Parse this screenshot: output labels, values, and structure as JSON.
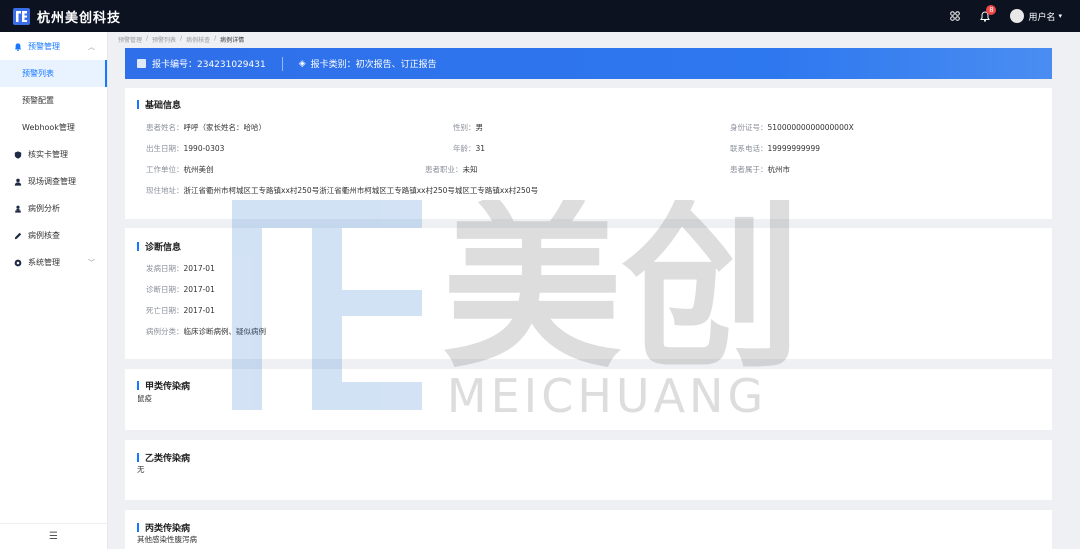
{
  "header": {
    "brand": "杭州美创科技",
    "notification_count": "8",
    "username": "用户名"
  },
  "sidebar": {
    "groups": [
      {
        "label": "预警管理",
        "icon": "bell-icon",
        "expanded": true,
        "children": [
          {
            "label": "预警列表",
            "active": true
          },
          {
            "label": "预警配置",
            "active": false
          },
          {
            "label": "Webhook管理",
            "active": false
          }
        ]
      },
      {
        "label": "核实卡管理",
        "icon": "shield-icon"
      },
      {
        "label": "现场调查管理",
        "icon": "person-icon"
      },
      {
        "label": "病例分析",
        "icon": "people-icon"
      },
      {
        "label": "病例核查",
        "icon": "edit-icon"
      },
      {
        "label": "系统管理",
        "icon": "settings-icon",
        "expanded": false
      }
    ]
  },
  "breadcrumb": [
    "预警管理",
    "预警列表",
    "病例核查",
    "病例详情"
  ],
  "banner": {
    "card_no": "报卡编号：234231029431",
    "card_type": "报卡类别：初次报告、订正报告"
  },
  "basic_info": {
    "title": "基础信息",
    "patient_name_label": "患者姓名：",
    "patient_name": "呼呼（家长姓名：哈哈）",
    "gender_label": "性别：",
    "gender": "男",
    "id_label": "身份证号：",
    "id": "51000000000000000X",
    "birth_label": "出生日期：",
    "birth": "1990-0303",
    "age_label": "年龄：",
    "age": "31",
    "phone_label": "联系电话：",
    "phone": "19999999999",
    "work_label": "工作单位：",
    "work": "杭州美创",
    "job_label": "患者职业：",
    "job": "未知",
    "belong_label": "患者属于：",
    "belong": "杭州市",
    "address_label": "现住地址：",
    "address": "浙江省衢州市柯城区工专路镇xx村250号浙江省衢州市柯城区工专路镇xx村250号城区工专路镇xx村250号"
  },
  "diagnosis": {
    "title": "诊断信息",
    "onset_label": "发病日期：",
    "onset": "2017-01",
    "diag_label": "诊断日期：",
    "diag": "2017-01",
    "death_label": "死亡日期：",
    "death": "2017-01",
    "class_label": "病例分类：",
    "class": "临床诊断病例、疑似病例"
  },
  "class_a": {
    "title": "甲类传染病",
    "value": "鼠疫"
  },
  "class_b": {
    "title": "乙类传染病",
    "value": "无"
  },
  "class_c": {
    "title": "丙类传染病",
    "value": "其他感染性腹泻病"
  },
  "watermark": {
    "brand_cn": "美创",
    "brand_en": "MEICHUANG"
  },
  "colors": {
    "accent": "#1677ff",
    "header_bg": "#0c1220",
    "banner": "#2f6fe9"
  }
}
